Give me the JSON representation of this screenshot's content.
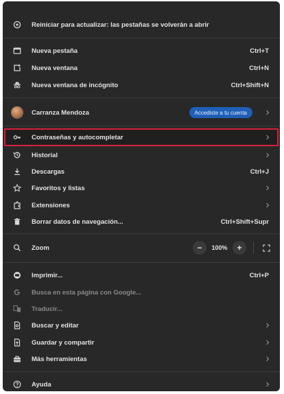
{
  "colors": {
    "menu_bg": "#282828",
    "text": "#e3e3e3",
    "highlight_border": "#d61e3c",
    "badge_bg": "#1f5fb8",
    "dim_text": "#8a8a8a"
  },
  "update": {
    "label": "Reiniciar para actualizar: las pestañas se volverán a abrir",
    "icon": "restart-icon"
  },
  "new_tab": {
    "label": "Nueva pestaña",
    "shortcut": "Ctrl+T",
    "icon": "new-tab-icon"
  },
  "new_window": {
    "label": "Nueva ventana",
    "shortcut": "Ctrl+N",
    "icon": "new-window-icon"
  },
  "incognito": {
    "label": "Nueva ventana de incógnito",
    "shortcut": "Ctrl+Shift+N",
    "icon": "incognito-icon"
  },
  "profile": {
    "name": "Carranza Mendoza",
    "badge": "Accediste a tu cuenta",
    "icon": "avatar"
  },
  "passwords": {
    "label": "Contraseñas y autocompletar",
    "icon": "key-icon"
  },
  "history": {
    "label": "Historial",
    "icon": "history-icon"
  },
  "downloads": {
    "label": "Descargas",
    "shortcut": "Ctrl+J",
    "icon": "download-icon"
  },
  "bookmarks": {
    "label": "Favoritos y listas",
    "icon": "star-icon"
  },
  "extensions": {
    "label": "Extensiones",
    "icon": "extension-icon"
  },
  "clear_data": {
    "label": "Borrar datos de navegación...",
    "shortcut": "Ctrl+Shift+Supr",
    "icon": "trash-icon"
  },
  "zoom": {
    "label": "Zoom",
    "minus": "−",
    "value": "100%",
    "plus": "+",
    "icon": "zoom-icon"
  },
  "print": {
    "label": "Imprimir...",
    "shortcut": "Ctrl+P",
    "icon": "print-icon"
  },
  "search_page": {
    "label": "Busca en esta página con Google...",
    "icon": "google-icon"
  },
  "translate": {
    "label": "Traducir...",
    "icon": "translate-icon"
  },
  "find_edit": {
    "label": "Buscar y editar",
    "icon": "find-icon"
  },
  "save_share": {
    "label": "Guardar y compartir",
    "icon": "save-share-icon"
  },
  "more_tools": {
    "label": "Más herramientas",
    "icon": "toolbox-icon"
  },
  "help": {
    "label": "Ayuda",
    "icon": "help-icon"
  }
}
